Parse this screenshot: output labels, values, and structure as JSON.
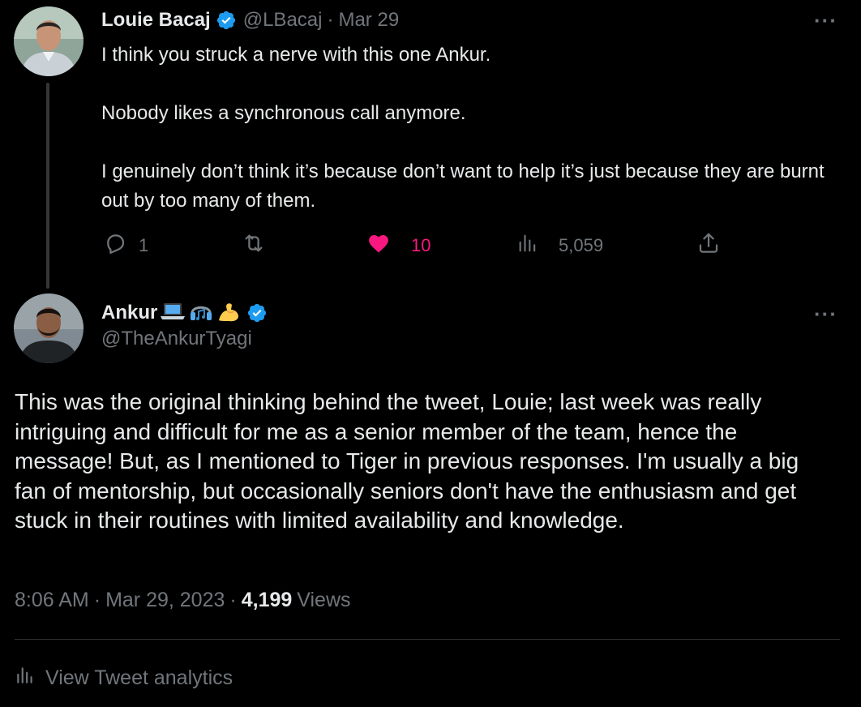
{
  "parent_tweet": {
    "author_name": "Louie Bacaj",
    "handle": "@LBacaj",
    "separator": "·",
    "date": "Mar 29",
    "more_label": "···",
    "paragraphs": [
      "I think you struck a nerve with this one Ankur.",
      "Nobody likes a synchronous call anymore.",
      "I genuinely don’t think it’s because don’t want to help it’s just because they are burnt out by too many of them."
    ],
    "actions": {
      "reply_count": "1",
      "retweet_count": "",
      "like_count": "10",
      "views_count": "5,059"
    }
  },
  "main_tweet": {
    "author_name": "Ankur",
    "name_emojis": [
      "laptop-emoji",
      "headphones-emoji",
      "flexed-biceps-emoji"
    ],
    "handle": "@TheAnkurTyagi",
    "more_label": "···",
    "text": "This was the original thinking behind the tweet, Louie; last week was really intriguing and difficult for me as a senior member of the team, hence the message! But, as I mentioned to Tiger in previous responses. I'm usually a big fan of mentorship, but occasionally seniors don't have the enthusiasm and get stuck in their routines with limited availability and knowledge.",
    "time": "8:06 AM",
    "separator": "·",
    "date": "Mar 29, 2023",
    "views_count": "4,199",
    "views_label": "Views",
    "analytics_label": "View Tweet analytics"
  },
  "colors": {
    "background": "#000000",
    "primary_text": "#e7e9ea",
    "secondary_text": "#71767b",
    "verified_blue": "#1d9bf0",
    "like_pink": "#f91880",
    "divider": "#2f3336"
  }
}
